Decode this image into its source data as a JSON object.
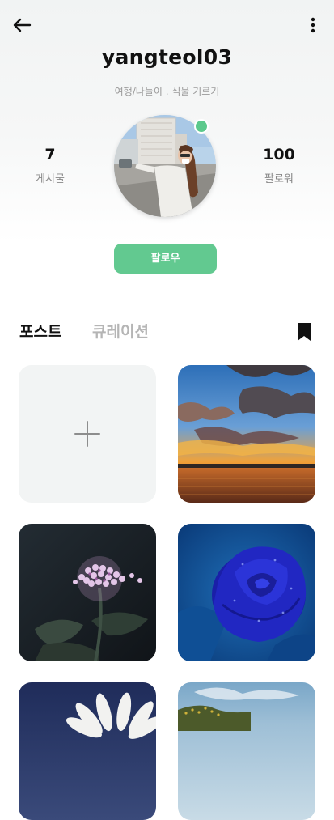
{
  "profile": {
    "username": "yangteol03",
    "bio": "여행/나들이 . 식물 기르기",
    "online": true
  },
  "stats": {
    "posts_count": "7",
    "posts_label": "게시물",
    "followers_count": "100",
    "followers_label": "팔로워"
  },
  "actions": {
    "follow_label": "팔로우"
  },
  "tabs": {
    "posts": "포스트",
    "curation": "큐레이션"
  },
  "colors": {
    "accent": "#62c990",
    "online": "#5cc98c"
  },
  "icons": {
    "back": "arrow-left-icon",
    "more": "more-vertical-icon",
    "bookmark": "bookmark-icon",
    "add": "plus-icon"
  },
  "grid": {
    "items": [
      "add-post",
      "sunset-sky",
      "lilac-flower",
      "blue-rose",
      "white-daisy",
      "green-field"
    ]
  }
}
